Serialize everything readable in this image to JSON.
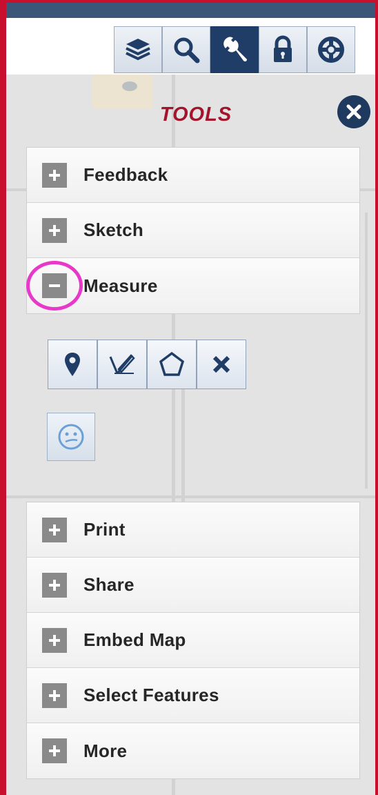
{
  "panel": {
    "title": "TOOLS"
  },
  "toolbar": {
    "buttons": [
      {
        "name": "layers-button",
        "icon": "layers-icon",
        "active": false
      },
      {
        "name": "search-button",
        "icon": "search-icon",
        "active": true
      },
      {
        "name": "tools-button",
        "icon": "wrench-icon",
        "active": true
      },
      {
        "name": "lock-button",
        "icon": "lock-icon",
        "active": false
      },
      {
        "name": "help-button",
        "icon": "lifebuoy-icon",
        "active": false
      }
    ]
  },
  "accordion_top": [
    {
      "label": "Feedback",
      "state": "collapsed"
    },
    {
      "label": "Sketch",
      "state": "collapsed"
    },
    {
      "label": "Measure",
      "state": "expanded"
    }
  ],
  "measure_tools": [
    {
      "name": "measure-point-button",
      "icon": "map-pin-icon"
    },
    {
      "name": "measure-distance-button",
      "icon": "pencil-line-icon"
    },
    {
      "name": "measure-area-button",
      "icon": "pentagon-icon"
    },
    {
      "name": "measure-clear-button",
      "icon": "x-icon"
    }
  ],
  "accordion_bottom": [
    {
      "label": "Print",
      "state": "collapsed"
    },
    {
      "label": "Share",
      "state": "collapsed"
    },
    {
      "label": "Embed Map",
      "state": "collapsed"
    },
    {
      "label": "Select Features",
      "state": "collapsed"
    },
    {
      "label": "More",
      "state": "collapsed"
    }
  ],
  "colors": {
    "title": "#a3152c",
    "toolbar_active": "#1f3d66",
    "highlight": "#e838c9",
    "frame_border": "#c8102e"
  }
}
